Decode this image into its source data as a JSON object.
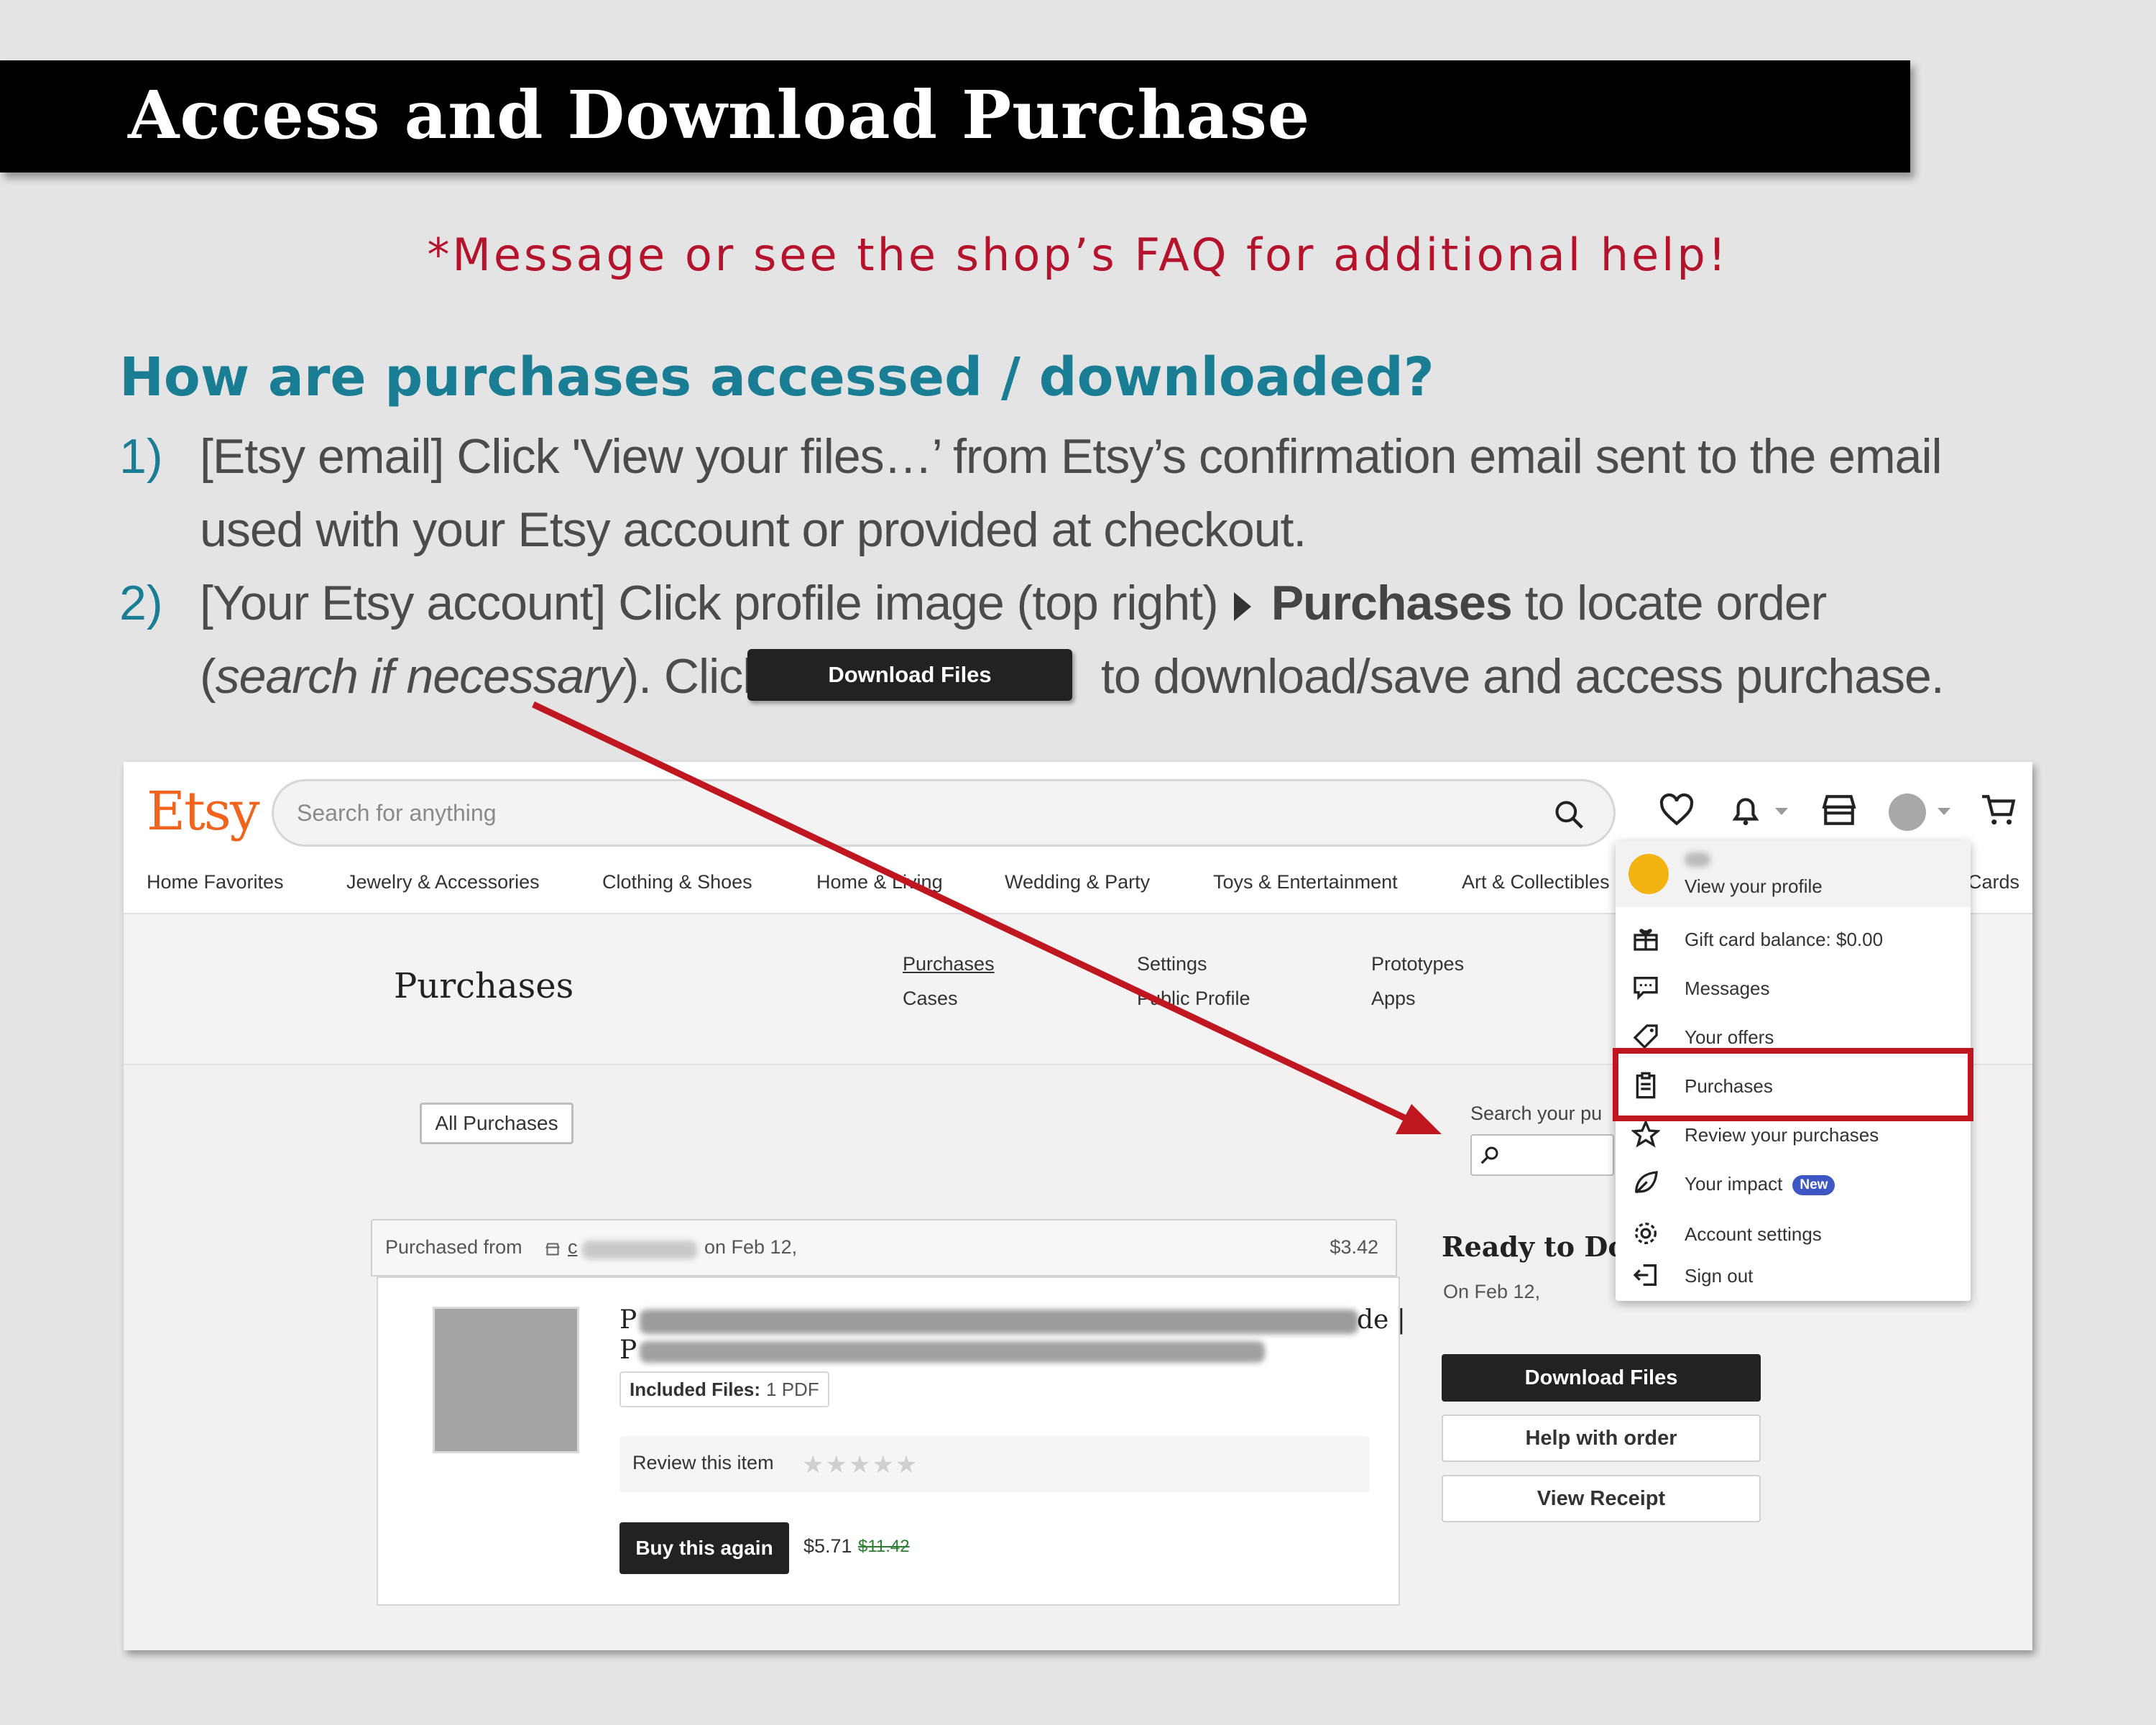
{
  "header": {
    "title": "Access and Download Purchase"
  },
  "help_note": "*Message or see the shop’s FAQ for additional help!",
  "question": "How are purchases accessed / downloaded?",
  "steps": {
    "s1_num": "1)",
    "s1_line1": "[Etsy email] Click 'View your files…’ from Etsy’s confirmation email sent to the email",
    "s1_line2": "used with your Etsy account or provided at checkout.",
    "s2_num": "2)",
    "s2_line1_a": "[Your Etsy account] Click profile image (top right)",
    "s2_line1_bold": "Purchases",
    "s2_line1_b": " to locate order",
    "s2_line2_a": "(",
    "s2_line2_italic": "search if necessary",
    "s2_line2_b": "). Click",
    "s2_button": "Download Files",
    "s2_line2_c": "to download/save and access purchase."
  },
  "etsy": {
    "logo": "Etsy",
    "search_placeholder": "Search for anything",
    "categories": [
      "Home Favorites",
      "Jewelry & Accessories",
      "Clothing & Shoes",
      "Home & Living",
      "Wedding & Party",
      "Toys & Entertainment",
      "Art & Collectibles",
      "Cards"
    ],
    "page_title": "Purchases",
    "subnav": [
      "Purchases",
      "Cases",
      "Settings",
      "Public Profile",
      "Prototypes",
      "Apps"
    ],
    "all_purchases": "All Purchases",
    "search_your": "Search your pu",
    "order": {
      "purchased_from": "Purchased from",
      "shop_initial": "c",
      "date": "on Feb 12,",
      "price": "$3.42",
      "title_start_1": "P",
      "title_end_1": "de |",
      "title_start_2": "P",
      "included_label": "Included Files:",
      "included_value": "1 PDF",
      "review": "Review this item",
      "stars": "★★★★★",
      "buy_again": "Buy this again",
      "price_now": "$5.71",
      "price_was": "$11.42"
    },
    "ready": "Ready to Dow",
    "ready_date": "On Feb 12,",
    "download_files": "Download Files",
    "help_order": "Help with order",
    "view_receipt": "View Receipt",
    "menu": {
      "view_profile": "View your profile",
      "gift_card": "Gift card balance: $0.00",
      "messages": "Messages",
      "offers": "Your offers",
      "purchases": "Purchases",
      "review": "Review your purchases",
      "impact": "Your impact",
      "new_badge": "New",
      "account": "Account settings",
      "sign_out": "Sign out"
    }
  },
  "colors": {
    "title_bg": "#000000",
    "help_red": "#b5132b",
    "heading_teal": "#197e94",
    "etsy_orange": "#f1641e",
    "highlight_red": "#c0161f"
  }
}
